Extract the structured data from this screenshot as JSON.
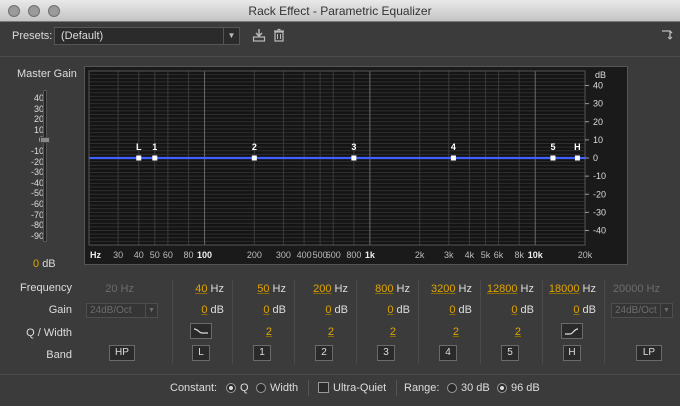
{
  "window": {
    "title": "Rack Effect - Parametric Equalizer"
  },
  "presets": {
    "label": "Presets:",
    "value": "(Default)"
  },
  "master_gain": {
    "label": "Master Gain",
    "value": "0",
    "unit": "dB",
    "scale": [
      "40",
      "30",
      "20",
      "10",
      "0",
      "-10",
      "-20",
      "-30",
      "-40",
      "-50",
      "-60",
      "-70",
      "-80",
      "-90"
    ]
  },
  "graph": {
    "db_label": "dB",
    "db_ticks": [
      "40",
      "30",
      "20",
      "10",
      "0",
      "-10",
      "-20",
      "-30",
      "-40"
    ],
    "freq_ticks": [
      {
        "label": "Hz",
        "f": 20,
        "bold": true
      },
      {
        "label": "30",
        "f": 30
      },
      {
        "label": "40",
        "f": 40
      },
      {
        "label": "50",
        "f": 50
      },
      {
        "label": "60",
        "f": 60
      },
      {
        "label": "80",
        "f": 80
      },
      {
        "label": "100",
        "f": 100,
        "bold": true
      },
      {
        "label": "200",
        "f": 200
      },
      {
        "label": "300",
        "f": 300
      },
      {
        "label": "400",
        "f": 400
      },
      {
        "label": "500",
        "f": 500
      },
      {
        "label": "600",
        "f": 600
      },
      {
        "label": "800",
        "f": 800
      },
      {
        "label": "1k",
        "f": 1000,
        "bold": true
      },
      {
        "label": "2k",
        "f": 2000
      },
      {
        "label": "3k",
        "f": 3000
      },
      {
        "label": "4k",
        "f": 4000
      },
      {
        "label": "5k",
        "f": 5000
      },
      {
        "label": "6k",
        "f": 6000
      },
      {
        "label": "8k",
        "f": 8000
      },
      {
        "label": "10k",
        "f": 10000,
        "bold": true
      },
      {
        "label": "20k",
        "f": 20000
      }
    ],
    "curve_gain_db": 0,
    "nodes": [
      {
        "label": "L",
        "f": 40
      },
      {
        "label": "1",
        "f": 50
      },
      {
        "label": "2",
        "f": 200
      },
      {
        "label": "3",
        "f": 800
      },
      {
        "label": "4",
        "f": 3200
      },
      {
        "label": "5",
        "f": 12800
      },
      {
        "label": "H",
        "f": 18000
      }
    ],
    "curve_color": "#3f5fff"
  },
  "rows": {
    "frequency": "Frequency",
    "gain": "Gain",
    "q_width": "Q / Width",
    "band": "Band"
  },
  "units": {
    "hz": "Hz",
    "db": "dB"
  },
  "bands": {
    "hp": {
      "freq": "20",
      "gain": "24dB/Oct",
      "button": "HP"
    },
    "b": [
      {
        "freq": "40",
        "gain": "0",
        "q": "",
        "button": "L"
      },
      {
        "freq": "50",
        "gain": "0",
        "q": "2",
        "button": "1"
      },
      {
        "freq": "200",
        "gain": "0",
        "q": "2",
        "button": "2"
      },
      {
        "freq": "800",
        "gain": "0",
        "q": "2",
        "button": "3"
      },
      {
        "freq": "3200",
        "gain": "0",
        "q": "2",
        "button": "4"
      },
      {
        "freq": "12800",
        "gain": "0",
        "q": "2",
        "button": "5"
      },
      {
        "freq": "18000",
        "gain": "0",
        "q": "",
        "button": "H"
      }
    ],
    "lp": {
      "freq": "20000",
      "gain": "24dB/Oct",
      "button": "LP"
    }
  },
  "bottom": {
    "constant_label": "Constant:",
    "q_label": "Q",
    "width_label": "Width",
    "constant_selected": "Q",
    "ultra_quiet_label": "Ultra-Quiet",
    "ultra_quiet_checked": false,
    "range_label": "Range:",
    "range_30": "30 dB",
    "range_96": "96 dB",
    "range_selected": "96 dB"
  }
}
